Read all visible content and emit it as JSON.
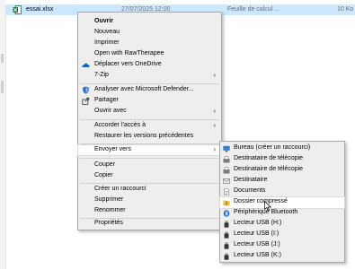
{
  "files": [
    {
      "name": "",
      "date": "",
      "type": "",
      "size": ""
    },
    {
      "name": "essai.xlsx",
      "date": "27/07/2025 12:00",
      "type": "Feuille de calcul ...",
      "size": "10 Ko"
    }
  ],
  "context_menu": {
    "items": [
      {
        "label": "Ouvrir",
        "bold": true
      },
      {
        "label": "Nouveau"
      },
      {
        "label": "Imprimer"
      },
      {
        "label": "Open with RawTherapee"
      },
      {
        "label": "Déplacer vers OneDrive",
        "icon": "onedrive-cloud-icon"
      },
      {
        "label": "7-Zip",
        "submenu": true
      },
      {
        "label": "Analyser avec Microsoft Defender...",
        "icon": "defender-shield-icon"
      },
      {
        "label": "Partager",
        "icon": "share-icon"
      },
      {
        "label": "Ouvrir avec",
        "submenu": true
      },
      {
        "label": "Accorder l'accès à",
        "submenu": true
      },
      {
        "label": "Restaurer les versions précédentes"
      },
      {
        "label": "Envoyer vers",
        "submenu": true,
        "highlighted": true
      },
      {
        "label": "Couper"
      },
      {
        "label": "Copier"
      },
      {
        "label": "Créer un raccourci"
      },
      {
        "label": "Supprimer"
      },
      {
        "label": "Renommer"
      },
      {
        "label": "Propriétés"
      }
    ],
    "arrow": "›"
  },
  "send_to_menu": {
    "items": [
      {
        "label": "Bureau (créer un raccourci)",
        "icon": "desktop-icon"
      },
      {
        "label": "Destinataire de télécopie",
        "icon": "fax-icon"
      },
      {
        "label": "Destinataire de télécopie",
        "icon": "fax-icon"
      },
      {
        "label": "Destinataire",
        "icon": "mail-recipient-icon"
      },
      {
        "label": "Documents",
        "icon": "documents-icon"
      },
      {
        "label": "Dossier compressé",
        "icon": "zip-folder-icon",
        "highlighted": true
      },
      {
        "label": "Périphérique Bluetooth",
        "icon": "bluetooth-icon"
      },
      {
        "label": "Lecteur USB (H:)",
        "icon": "usb-drive-icon"
      },
      {
        "label": "Lecteur USB (I:)",
        "icon": "usb-drive-icon"
      },
      {
        "label": "Lecteur USB (J:)",
        "icon": "usb-drive-icon"
      },
      {
        "label": "Lecteur USB (K:)",
        "icon": "usb-drive-icon"
      }
    ]
  },
  "colors": {
    "selection": "#cce8ff",
    "menu_bg": "#eeeeee",
    "highlight": "#ffffff",
    "excel_green": "#1d6f42",
    "onedrive_blue": "#0a64c8",
    "bluetooth_blue": "#1a6fd0"
  }
}
